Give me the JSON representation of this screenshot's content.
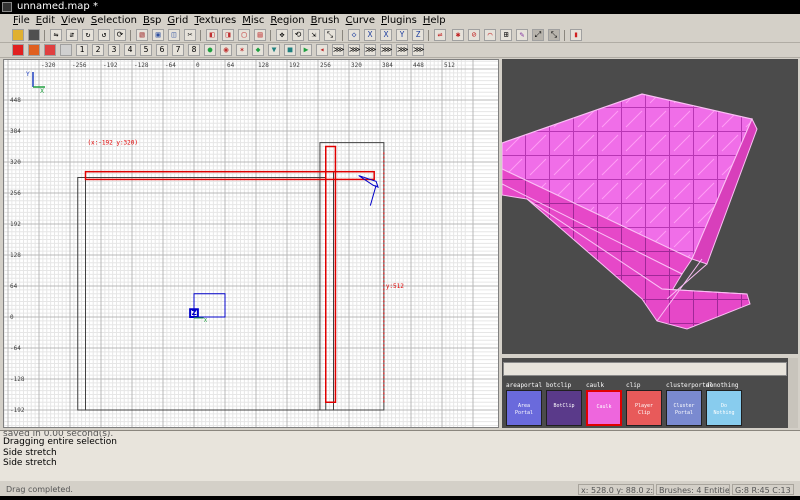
{
  "window": {
    "title": "unnamed.map *"
  },
  "menu": [
    {
      "key": "F",
      "rest": "ile"
    },
    {
      "key": "E",
      "rest": "dit"
    },
    {
      "key": "V",
      "rest": "iew"
    },
    {
      "key": "S",
      "rest": "election"
    },
    {
      "key": "B",
      "rest": "sp"
    },
    {
      "key": "G",
      "rest": "rid"
    },
    {
      "key": "T",
      "rest": "extures"
    },
    {
      "key": "M",
      "rest": "isc"
    },
    {
      "key": "R",
      "rest": "egion"
    },
    {
      "key": "B",
      "rest": "rush"
    },
    {
      "key": "C",
      "rest": "urve"
    },
    {
      "key": "P",
      "rest": "lugins"
    },
    {
      "key": "H",
      "rest": "elp"
    }
  ],
  "grid_buttons": [
    "1",
    "2",
    "3",
    "4",
    "5",
    "6",
    "7",
    "8"
  ],
  "axis_buttons": [
    "X",
    "X",
    "Y",
    "Z"
  ],
  "grid_view": {
    "x_ruler": [
      "-320",
      "-256",
      "-192",
      "-128",
      "-64",
      "0",
      "64",
      "128",
      "192",
      "256",
      "320",
      "384",
      "448",
      "512"
    ],
    "y_ruler": [
      "448",
      "384",
      "320",
      "256",
      "192",
      "128",
      "64",
      "0",
      "-64",
      "-128",
      "-192"
    ],
    "axis_y": "Y",
    "axis_x": "X",
    "origin_label": "Z",
    "origin_x_label": "X",
    "coord_label": "(x:-192  y:320)",
    "size_label": "y:512",
    "colors": {
      "grid": "#e6e6e6",
      "major": "#b8b8b8",
      "selected": "#e00000",
      "brush": "#000000",
      "entity": "#0000c8"
    }
  },
  "textures": [
    {
      "name": "areaportal",
      "label": "Area\nPortal",
      "color": "#6a6adc"
    },
    {
      "name": "botclip",
      "label": "BotClip",
      "color": "#5a3a8a"
    },
    {
      "name": "caulk",
      "label": "Caulk",
      "color": "#ee66dd"
    },
    {
      "name": "clip",
      "label": "Player\nClip",
      "color": "#e85a5a"
    },
    {
      "name": "clusterportal",
      "label": "Cluster\nPortal",
      "color": "#7a8ad0"
    },
    {
      "name": "donothing",
      "label": "Do\nNothing",
      "color": "#88ccee"
    }
  ],
  "console": {
    "partial": "saved in 0.00 second(s).",
    "lines": [
      "Dragging entire selection",
      "Side stretch",
      "Side stretch"
    ]
  },
  "status": {
    "message": "Drag completed.",
    "coords": "x: 528.0  y: 88.0  z: 0.0",
    "brushes": "Brushes: 4  Entities: 1",
    "grid": "G:8  R:45  C:13  L:MR"
  }
}
